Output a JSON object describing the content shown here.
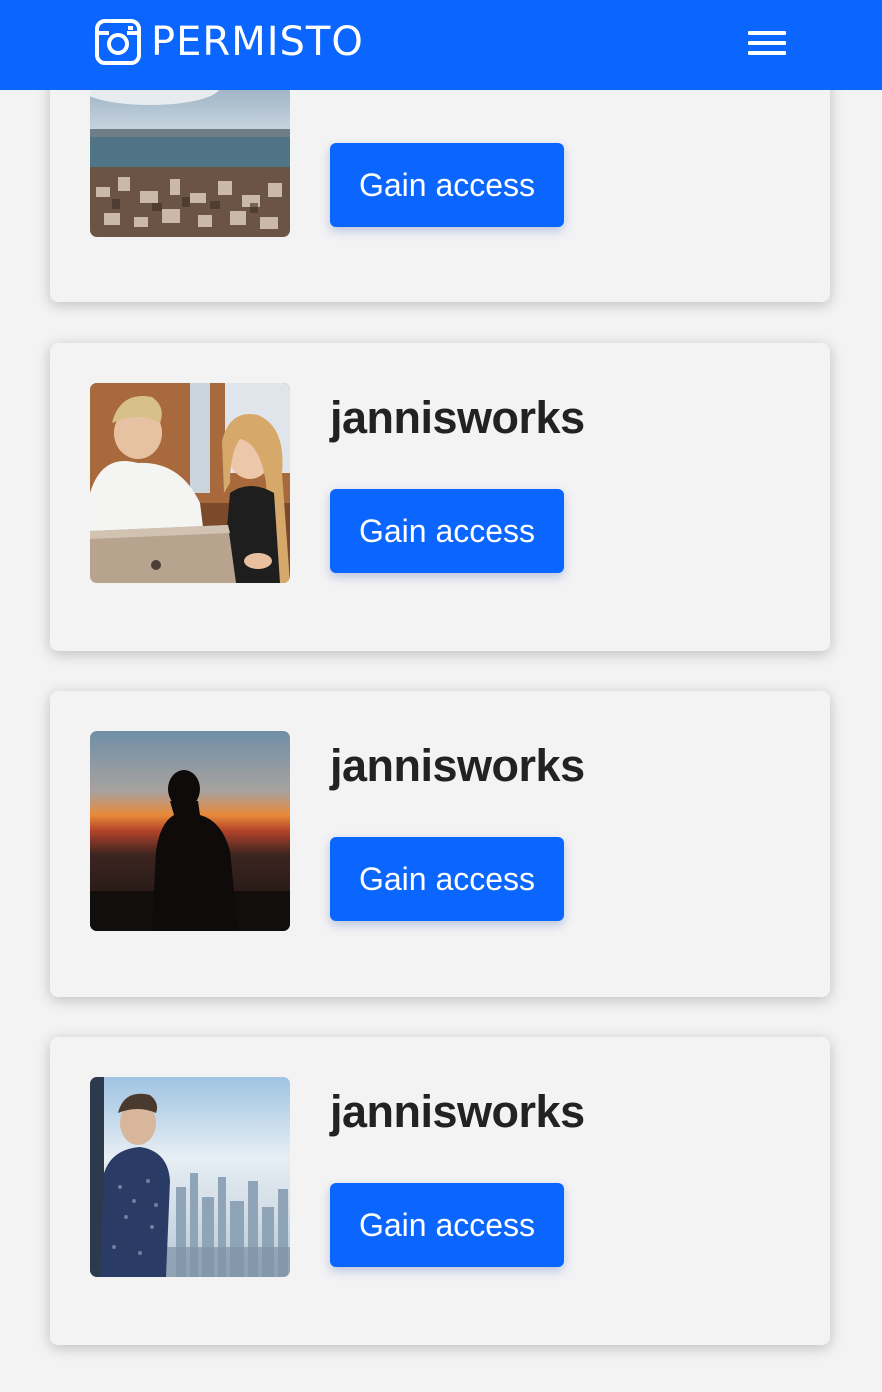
{
  "header": {
    "brand": "PERMISTO",
    "brand_color": "#0a66ff",
    "logo_icon": "camera-icon",
    "menu_icon": "hamburger-menu-icon"
  },
  "cards": [
    {
      "username": "",
      "button_label": "Gain access",
      "thumbnail": "city-coastline-photo"
    },
    {
      "username": "jannisworks",
      "button_label": "Gain access",
      "thumbnail": "two-people-at-laptop-photo"
    },
    {
      "username": "jannisworks",
      "button_label": "Gain access",
      "thumbnail": "silhouette-at-sunset-photo"
    },
    {
      "username": "jannisworks",
      "button_label": "Gain access",
      "thumbnail": "man-at-window-cityscape-photo"
    }
  ]
}
